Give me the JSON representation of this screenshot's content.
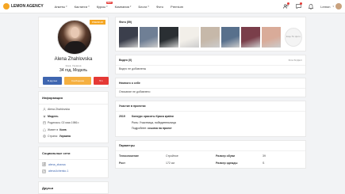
{
  "nav": {
    "logo_text": "LEMON AGENCY",
    "menu": [
      {
        "label": "Анкеты",
        "caret": true
      },
      {
        "label": "Кастинги",
        "caret": true
      },
      {
        "label": "Курсы",
        "caret": true,
        "badge": "NEW"
      },
      {
        "label": "Компания",
        "caret": true
      },
      {
        "label": "Блоги",
        "caret": true
      },
      {
        "label": "Фото",
        "caret": false
      },
      {
        "label": "Premium",
        "caret": false
      }
    ],
    "user_name": "Lemon"
  },
  "profile": {
    "premium_label": "PREMIUM",
    "name": "Alena Zhahlovska",
    "location": "Киев, Украина",
    "age_role": "34 год, Модель",
    "btn_friend": "В друзья",
    "btn_message": "Сообщение",
    "btn_like": "1"
  },
  "info": {
    "title": "Информация",
    "rows": [
      {
        "icon": "user-icon",
        "text": "Alena Zhahlovska"
      },
      {
        "icon": "star-icon",
        "text": "Модель",
        "bold": true
      },
      {
        "icon": "calendar-icon",
        "text": "Родилась: 02 мая 1986 г."
      },
      {
        "icon": "home-icon",
        "prefix": "Живет в ",
        "value": "Киев"
      },
      {
        "icon": "globe-icon",
        "prefix": "Страна: ",
        "value": "Украина"
      }
    ]
  },
  "social": {
    "title": "Социальные сети",
    "rows": [
      {
        "icon": "facebook-icon",
        "text": "alena_zbavsa"
      },
      {
        "icon": "instagram-icon",
        "text": "alena.lichenko.1"
      }
    ]
  },
  "friends_title": "Друзья",
  "photos": {
    "title": "Фото (59)",
    "more_label": "Еще 51 фото",
    "thumb_colors": [
      "#3b3f4c",
      "#6f7f95",
      "#2a2f33",
      "#f2efe9",
      "#c6b8a9",
      "#58708c",
      "#7a3e4a",
      "#d9ab99"
    ]
  },
  "video": {
    "title": "Видео (0)",
    "all_label": "ВСЕ ВИДЕО",
    "empty": "Видео не добавлены"
  },
  "about": {
    "title": "Немного о себе",
    "empty": "Описание не добавлено"
  },
  "projects": {
    "title": "Участие в проектах",
    "year": "2019",
    "name": "Конкурс красоты Краса країни",
    "role": "Роль: Участница, победительница",
    "details_prefix": "Подробнее: ",
    "details_link": "ссылка на проект"
  },
  "params": {
    "title": "Параметры",
    "rows": [
      {
        "k1": "Телосложение",
        "v1": "Стройное",
        "k2": "Размер обуви",
        "v2": "39"
      },
      {
        "k1": "Рост",
        "v1": "172 см",
        "k2": "Размер одежды",
        "v2": "S"
      }
    ]
  }
}
